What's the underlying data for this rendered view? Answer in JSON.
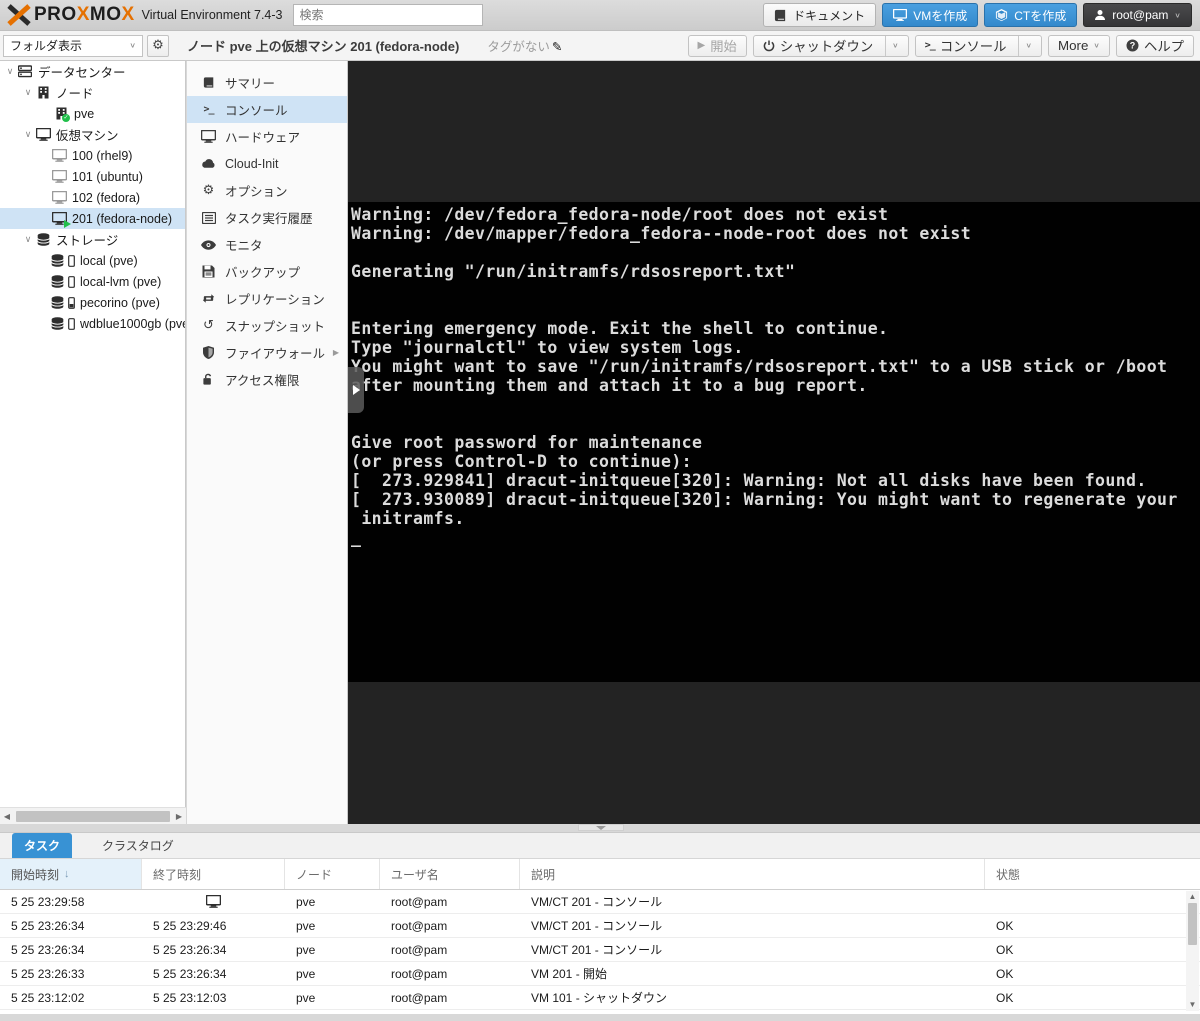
{
  "header": {
    "brand_p1": "PRO",
    "brand_x1": "X",
    "brand_p2": "MO",
    "brand_x2": "X",
    "subtitle": "Virtual Environment 7.4-3",
    "search_placeholder": "検索",
    "docs_label": "ドキュメント",
    "create_vm_label": "VMを作成",
    "create_ct_label": "CTを作成",
    "user_label": "root@pam"
  },
  "toolbar": {
    "view_select": "フォルダ表示",
    "breadcrumb": "ノード pve 上の仮想マシン 201 (fedora-node)",
    "tags_label": "タグがない",
    "start_label": "開始",
    "shutdown_label": "シャットダウン",
    "console_label": "コンソール",
    "more_label": "More",
    "help_label": "ヘルプ"
  },
  "sidebar": {
    "datacenter": "データセンター",
    "nodes_group": "ノード",
    "node_pve": "pve",
    "vms_group": "仮想マシン",
    "vm_100": "100 (rhel9)",
    "vm_101": "101 (ubuntu)",
    "vm_102": "102 (fedora)",
    "vm_201": "201 (fedora-node)",
    "storage_group": "ストレージ",
    "st_local": "local (pve)",
    "st_local_lvm": "local-lvm (pve)",
    "st_pecorino": "pecorino (pve)",
    "st_wdblue": "wdblue1000gb (pve"
  },
  "menu": {
    "summary": "サマリー",
    "console": "コンソール",
    "hardware": "ハードウェア",
    "cloudinit": "Cloud-Init",
    "options": "オプション",
    "task_history": "タスク実行履歴",
    "monitor": "モニタ",
    "backup": "バックアップ",
    "replication": "レプリケーション",
    "snapshot": "スナップショット",
    "firewall": "ファイアウォール",
    "permissions": "アクセス権限"
  },
  "console": {
    "lines": [
      "Warning: /dev/fedora_fedora-node/root does not exist",
      "Warning: /dev/mapper/fedora_fedora--node-root does not exist",
      "",
      "Generating \"/run/initramfs/rdsosreport.txt\"",
      "",
      "",
      "Entering emergency mode. Exit the shell to continue.",
      "Type \"journalctl\" to view system logs.",
      "You might want to save \"/run/initramfs/rdsosreport.txt\" to a USB stick or /boot",
      "after mounting them and attach it to a bug report.",
      "",
      "",
      "Give root password for maintenance",
      "(or press Control-D to continue):",
      "[  273.929841] dracut-initqueue[320]: Warning: Not all disks have been found.",
      "[  273.930089] dracut-initqueue[320]: Warning: You might want to regenerate your",
      " initramfs.",
      "_"
    ]
  },
  "tasks": {
    "tab_tasks": "タスク",
    "tab_cluster_log": "クラスタログ",
    "columns": {
      "start": "開始時刻",
      "end": "終了時刻",
      "node": "ノード",
      "user": "ユーザ名",
      "desc": "説明",
      "status": "状態"
    },
    "sort_indicator": "↓",
    "rows": [
      {
        "start": "5 25 23:29:58",
        "end": "",
        "node": "pve",
        "user": "root@pam",
        "desc": "VM/CT 201 - コンソール",
        "status": ""
      },
      {
        "start": "5 25 23:26:34",
        "end": "5 25 23:29:46",
        "node": "pve",
        "user": "root@pam",
        "desc": "VM/CT 201 - コンソール",
        "status": "OK"
      },
      {
        "start": "5 25 23:26:34",
        "end": "5 25 23:26:34",
        "node": "pve",
        "user": "root@pam",
        "desc": "VM/CT 201 - コンソール",
        "status": "OK"
      },
      {
        "start": "5 25 23:26:33",
        "end": "5 25 23:26:34",
        "node": "pve",
        "user": "root@pam",
        "desc": "VM 201 - 開始",
        "status": "OK"
      },
      {
        "start": "5 25 23:12:02",
        "end": "5 25 23:12:03",
        "node": "pve",
        "user": "root@pam",
        "desc": "VM 101 - シャットダウン",
        "status": "OK"
      }
    ]
  },
  "colors": {
    "accent_blue": "#3892d4",
    "brand_orange": "#e57000",
    "selected_bg": "#cfe3f5",
    "console_bg": "#010101"
  }
}
